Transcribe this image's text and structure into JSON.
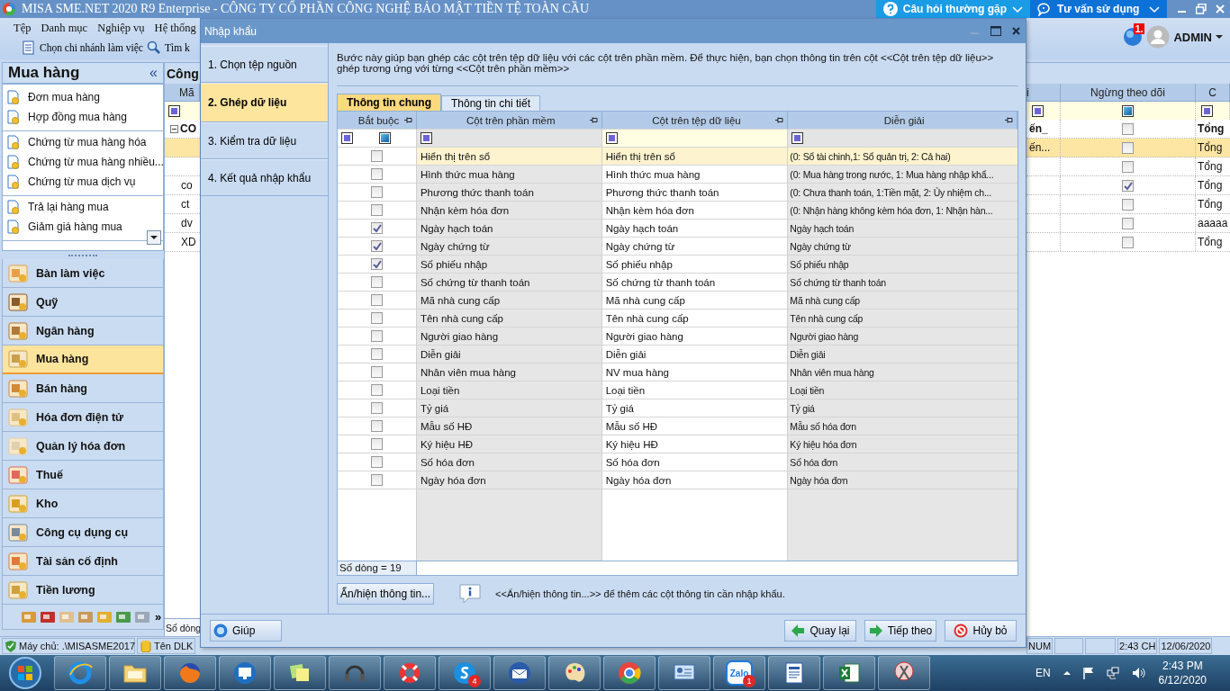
{
  "app": {
    "title": "MISA SME.NET 2020 R9 Enterprise - CÔNG TY CỔ PHẦN CÔNG NGHỆ BẢO MẬT TIỀN TỆ TOÀN CẦU",
    "help_buttons": [
      {
        "label": "Câu hỏi thường gặp",
        "kind": "faq"
      },
      {
        "label": "Tư vấn sử dụng",
        "kind": "support"
      }
    ]
  },
  "menu": [
    "Tệp",
    "Danh mục",
    "Nghiệp vụ",
    "Hệ thống"
  ],
  "toolbar": [
    {
      "label": "Chọn chi nhánh làm việc",
      "kind": "branch"
    },
    {
      "label": "Tìm k",
      "kind": "search"
    }
  ],
  "user": {
    "notification_badge": "1.",
    "name": "ADMIN"
  },
  "sidebar": {
    "title": "Mua hàng",
    "collapse": "«",
    "groups": [
      [
        "Đơn mua hàng",
        "Hợp đồng mua hàng"
      ],
      [
        "Chứng từ mua hàng hóa",
        "Chứng từ mua  hàng nhiều...",
        "Chứng từ mua dịch vụ"
      ],
      [
        "Trả lại hàng mua",
        "Giảm giá hàng mua"
      ]
    ],
    "modules": [
      {
        "label": "Bàn làm việc",
        "selected": false
      },
      {
        "label": "Quỹ",
        "selected": false
      },
      {
        "label": "Ngân hàng",
        "selected": false
      },
      {
        "label": "Mua hàng",
        "selected": true
      },
      {
        "label": "Bán hàng",
        "selected": false
      },
      {
        "label": "Hóa đơn điện tử",
        "selected": false
      },
      {
        "label": "Quản lý hóa đơn",
        "selected": false
      },
      {
        "label": "Thuế",
        "selected": false
      },
      {
        "label": "Kho",
        "selected": false
      },
      {
        "label": "Công cụ dụng cụ",
        "selected": false
      },
      {
        "label": "Tài sản cố định",
        "selected": false
      },
      {
        "label": "Tiền lương",
        "selected": false
      }
    ],
    "more": "»"
  },
  "main": {
    "title": "Công",
    "left_header": "Mã",
    "right_headers": [
      "i",
      "Ngừng theo dõi",
      "C"
    ],
    "rows": [
      {
        "kind": "group",
        "code": "CO",
        "column_1": "ến_",
        "stopped": false,
        "column_3": "Tổng",
        "selected": false
      },
      {
        "kind": "item",
        "column_1": "ến...",
        "stopped": false,
        "column_3": "Tổng",
        "selected": true
      },
      {
        "kind": "item",
        "stopped": false,
        "column_3": "Tổng",
        "selected": false
      },
      {
        "kind": "item",
        "code": "co",
        "stopped": true,
        "column_3": "Tổng",
        "selected": false
      },
      {
        "kind": "item",
        "code": "ct",
        "stopped": false,
        "column_3": "Tổng",
        "selected": false
      },
      {
        "kind": "item",
        "code": "dv",
        "stopped": false,
        "column_3": "aaaaa",
        "selected": false
      },
      {
        "kind": "item",
        "code": "XD",
        "stopped": false,
        "column_3": "Tổng",
        "selected": false
      }
    ],
    "footer": "Số dòng"
  },
  "dialog": {
    "title": "Nhập khẩu",
    "steps": [
      {
        "label": "1. Chọn tệp nguồn",
        "selected": false
      },
      {
        "label": "2. Ghép dữ liệu",
        "selected": true
      },
      {
        "label": "3. Kiểm tra dữ liệu",
        "selected": false
      },
      {
        "label": "4. Kết quả nhập khẩu",
        "selected": false
      }
    ],
    "description": "Bước này giúp bạn ghép các cột trên tệp dữ liệu với các cột trên phần mềm. Để thực hiện, bạn chọn thông tin trên cột <<Cột trên tệp dữ liệu>> ghép tương ứng với từng <<Cột trên phần mềm>>",
    "tabs": [
      {
        "label": "Thông tin chung",
        "selected": true
      },
      {
        "label": "Thông tin chi tiết",
        "selected": false
      }
    ],
    "grid": {
      "columns": [
        "Bắt buộc",
        "Cột trên phần mềm",
        "Cột trên tệp dữ liệu",
        "Diễn giải"
      ],
      "rows": [
        {
          "required": false,
          "selected": true,
          "software": "Hiển thị trên sổ",
          "file": "Hiển thị trên sổ",
          "note": "(0: Sổ tài chinh,1: Sổ quản trị, 2: Cả hai)"
        },
        {
          "required": false,
          "selected": false,
          "software": "Hình thức mua hàng",
          "file": "Hình thức mua hàng",
          "note": "(0: Mua hàng trong nước, 1: Mua hàng nhập khẩ..."
        },
        {
          "required": false,
          "selected": false,
          "software": "Phương thức thanh toán",
          "file": "Phương thức thanh toán",
          "note": "(0: Chưa thanh toán, 1:Tiền mặt, 2: Ủy nhiệm ch..."
        },
        {
          "required": false,
          "selected": false,
          "software": "Nhận kèm hóa đơn",
          "file": "Nhận kèm hóa đơn",
          "note": "(0: Nhận hàng không kèm hóa đơn, 1: Nhận hàn..."
        },
        {
          "required": true,
          "selected": false,
          "software": "Ngày hạch toán",
          "file": "Ngày hạch toán",
          "note": "Ngày hạch toán"
        },
        {
          "required": true,
          "selected": false,
          "software": "Ngày chứng từ",
          "file": "Ngày chứng từ",
          "note": "Ngày chứng từ"
        },
        {
          "required": true,
          "selected": false,
          "software": "Số phiếu nhập",
          "file": "Số phiếu nhập",
          "note": "Số phiếu nhập"
        },
        {
          "required": false,
          "selected": false,
          "software": "Số chứng từ thanh toán",
          "file": "Số chứng từ thanh toán",
          "note": "Số chứng từ thanh toán"
        },
        {
          "required": false,
          "selected": false,
          "software": "Mã nhà cung cấp",
          "file": "Mã nhà cung cấp",
          "note": "Mã nhà cung cấp"
        },
        {
          "required": false,
          "selected": false,
          "software": "Tên nhà cung cấp",
          "file": "Tên nhà cung cấp",
          "note": "Tên nhà cung cấp"
        },
        {
          "required": false,
          "selected": false,
          "software": "Người giao hàng",
          "file": "Người giao hàng",
          "note": "Người giao hàng"
        },
        {
          "required": false,
          "selected": false,
          "software": "Diễn giải",
          "file": "Diễn giải",
          "note": "Diễn giải"
        },
        {
          "required": false,
          "selected": false,
          "software": "Nhân viên mua hàng",
          "file": "NV mua hàng",
          "note": "Nhân viên mua hàng"
        },
        {
          "required": false,
          "selected": false,
          "software": "Loại tiền",
          "file": "Loại tiền",
          "note": "Loại tiền"
        },
        {
          "required": false,
          "selected": false,
          "software": "Tỷ giá",
          "file": "Tỷ giá",
          "note": "Tỷ giá"
        },
        {
          "required": false,
          "selected": false,
          "software": "Mẫu số HĐ",
          "file": "Mẫu số HĐ",
          "note": "Mẫu số hóa đơn"
        },
        {
          "required": false,
          "selected": false,
          "software": "Ký hiệu HĐ",
          "file": "Ký hiệu HĐ",
          "note": "Ký hiệu hóa đơn"
        },
        {
          "required": false,
          "selected": false,
          "software": "Số hóa đơn",
          "file": "Số hóa đơn",
          "note": "Số hóa đơn"
        },
        {
          "required": false,
          "selected": false,
          "software": "Ngày hóa đơn",
          "file": "Ngày hóa đơn",
          "note": "Ngày hóa đơn"
        }
      ],
      "footer": "Số dòng = 19"
    },
    "toggle_button": "Ẩn/hiện thông tin...",
    "hint": "<<Ẩn/hiện thông tin...>> để thêm các cột thông tin cần nhập khẩu.",
    "help_button": "Giúp",
    "buttons": [
      {
        "label": "Quay lại",
        "kind": "back"
      },
      {
        "label": "Tiếp theo",
        "kind": "next"
      },
      {
        "label": "Hủy bỏ",
        "kind": "cancel"
      }
    ]
  },
  "status_bar": {
    "left": [
      "Máy chủ: .\\MISASME2017",
      "Tên DLK"
    ],
    "right": [
      "NUM",
      "2:43 CH",
      "12/06/2020"
    ]
  },
  "taskbar": {
    "apps": [
      {
        "kind": "ie"
      },
      {
        "kind": "folder"
      },
      {
        "kind": "firefox"
      },
      {
        "kind": "remote"
      },
      {
        "kind": "notes"
      },
      {
        "kind": "headset"
      },
      {
        "kind": "lifebuoy"
      },
      {
        "kind": "skype",
        "badge": "4"
      },
      {
        "kind": "mail"
      },
      {
        "kind": "paint"
      },
      {
        "kind": "chrome"
      },
      {
        "kind": "panel"
      },
      {
        "kind": "zalo",
        "label": "Zalo",
        "badge": "1"
      },
      {
        "kind": "writer"
      },
      {
        "kind": "excel"
      },
      {
        "kind": "snip"
      }
    ],
    "language": "EN",
    "time": "2:43 PM",
    "date": "6/12/2020"
  }
}
